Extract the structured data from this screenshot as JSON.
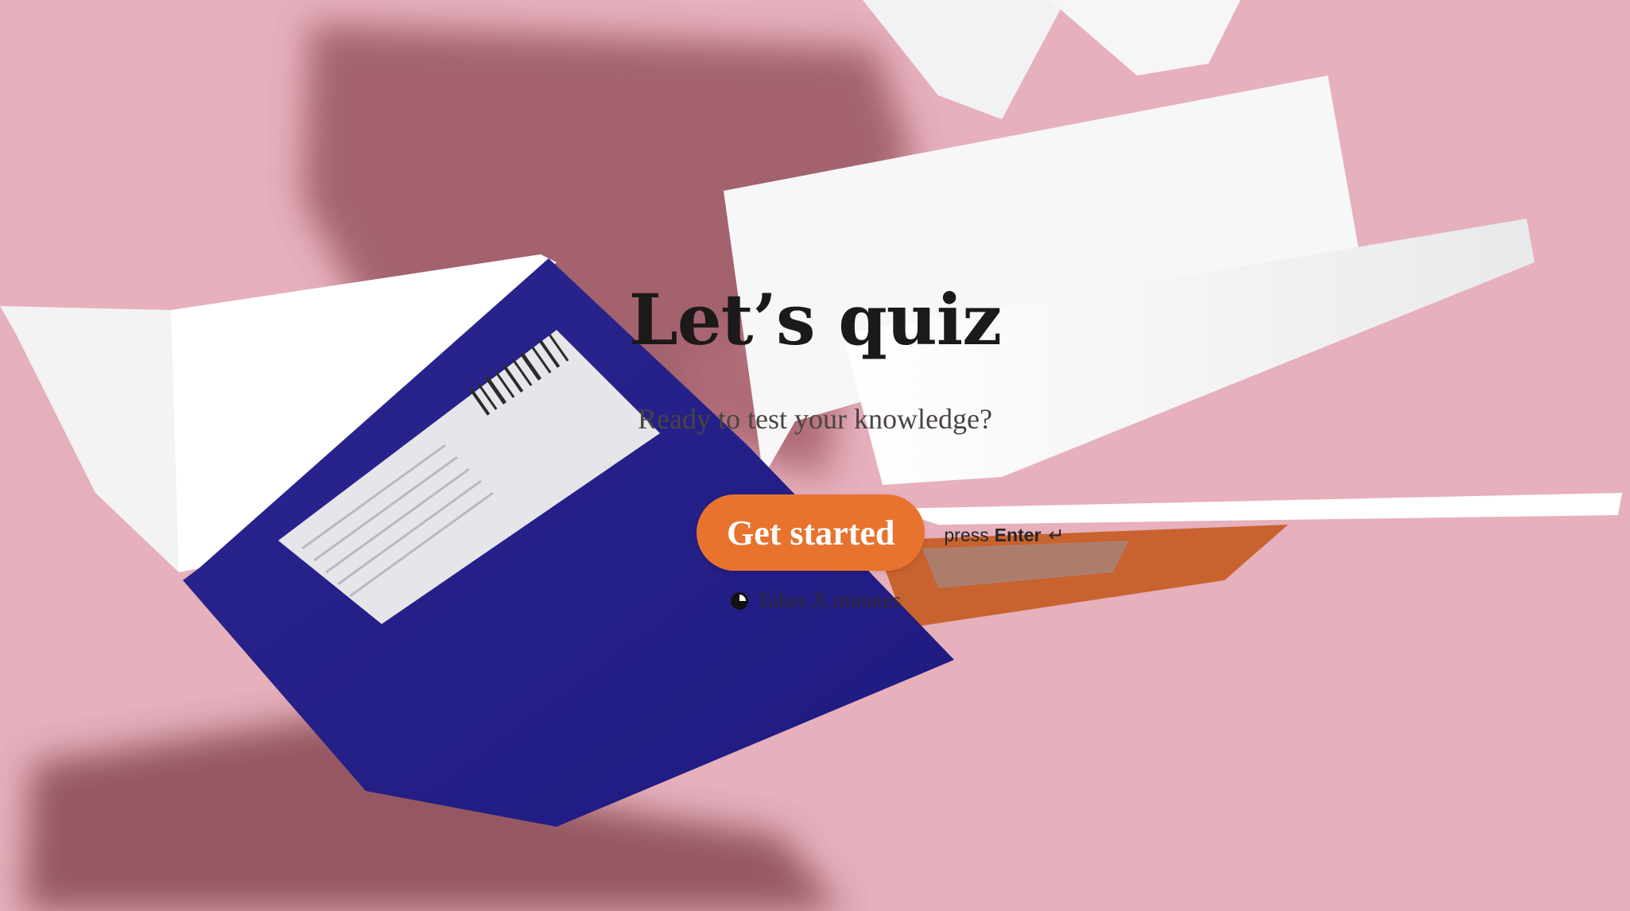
{
  "welcome": {
    "title": "Let’s quiz",
    "subtitle": "Ready to test your knowledge?",
    "start_button_label": "Get started",
    "enter_hint": {
      "prefix": "press",
      "key": "Enter",
      "icon": "return-key-icon"
    },
    "duration": {
      "icon": "clock-icon",
      "text": "Takes X minutes"
    }
  },
  "background": {
    "image": "flying-books-photo",
    "base_color": "#e8b3be",
    "book_cover_color": "#2a2388"
  },
  "colors": {
    "accent": "#e8732f",
    "title_text": "#1c1a19",
    "subtitle_text": "#4a4441"
  }
}
